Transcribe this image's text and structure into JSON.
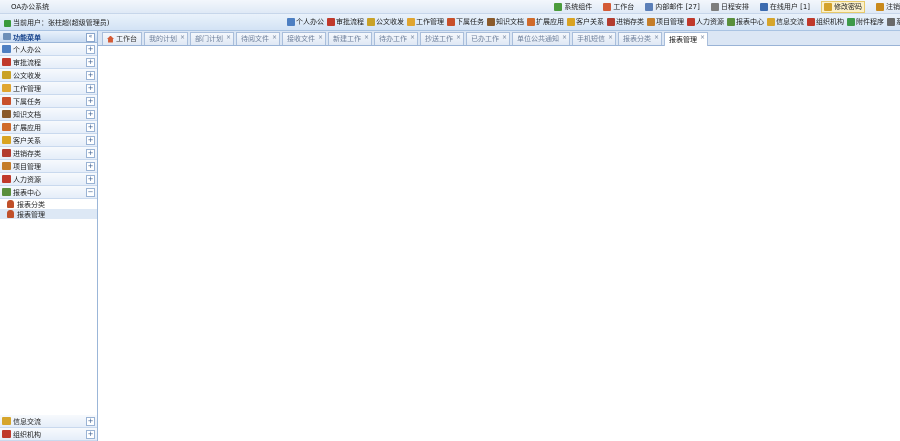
{
  "app": {
    "title": "OA办公系统"
  },
  "top_links": [
    {
      "label": "系统组件",
      "icon": "puzzle-icon",
      "color": "#4a9b3b"
    },
    {
      "label": "工作台",
      "icon": "home-icon",
      "color": "#d35a35"
    },
    {
      "label": "内部邮件 [27]",
      "icon": "mail-icon",
      "color": "#5b7fb8"
    },
    {
      "label": "日程安排",
      "icon": "calendar-icon",
      "color": "#7d7d7d"
    },
    {
      "label": "在线用户 [1]",
      "icon": "users-icon",
      "color": "#3b6bb0"
    },
    {
      "label": "修改密码",
      "icon": "key-icon",
      "color": "#d4a22a"
    },
    {
      "label": "注销",
      "icon": "logout-icon",
      "color": "#c98a1d"
    }
  ],
  "toolbar": {
    "current_user": "当前用户：张柱超(超级管理员)",
    "modules": [
      {
        "label": "个人办公",
        "icon": "personal-icon",
        "color": "#4d7fc2"
      },
      {
        "label": "审批流程",
        "icon": "approval-icon",
        "color": "#c0392b"
      },
      {
        "label": "公文收发",
        "icon": "document-icon",
        "color": "#c9a227"
      },
      {
        "label": "工作管理",
        "icon": "work-icon",
        "color": "#e0a530"
      },
      {
        "label": "下属任务",
        "icon": "task-icon",
        "color": "#c84f2a"
      },
      {
        "label": "知识文档",
        "icon": "knowledge-icon",
        "color": "#8a5a2b"
      },
      {
        "label": "扩展应用",
        "icon": "extension-icon",
        "color": "#d06a2a"
      },
      {
        "label": "客户关系",
        "icon": "customer-icon",
        "color": "#d9a322"
      },
      {
        "label": "进销存类",
        "icon": "inventory-icon",
        "color": "#b33c2f"
      },
      {
        "label": "项目管理",
        "icon": "project-icon",
        "color": "#c47d2a"
      },
      {
        "label": "人力资源",
        "icon": "hr-icon",
        "color": "#c0392b"
      },
      {
        "label": "报表中心",
        "icon": "report-icon",
        "color": "#5a8f3c"
      },
      {
        "label": "信息交流",
        "icon": "message-icon",
        "color": "#d6a52c"
      },
      {
        "label": "组织机构",
        "icon": "org-icon",
        "color": "#c0392b"
      },
      {
        "label": "附件程序",
        "icon": "attachment-icon",
        "color": "#3e9a4a"
      },
      {
        "label": "系统设置",
        "icon": "settings-icon",
        "color": "#6a6a6a"
      }
    ]
  },
  "sidebar": {
    "title": "功能菜单",
    "collapse_symbol": "«",
    "items": [
      {
        "label": "个人办公",
        "icon": "personal-icon",
        "color": "#4d7fc2",
        "toggle": "+"
      },
      {
        "label": "审批流程",
        "icon": "approval-icon",
        "color": "#c0392b",
        "toggle": "+"
      },
      {
        "label": "公文收发",
        "icon": "document-icon",
        "color": "#c9a227",
        "toggle": "+"
      },
      {
        "label": "工作管理",
        "icon": "work-icon",
        "color": "#e0a530",
        "toggle": "+"
      },
      {
        "label": "下属任务",
        "icon": "task-icon",
        "color": "#c84f2a",
        "toggle": "+"
      },
      {
        "label": "知识文档",
        "icon": "knowledge-icon",
        "color": "#8a5a2b",
        "toggle": "+"
      },
      {
        "label": "扩展应用",
        "icon": "extension-icon",
        "color": "#d06a2a",
        "toggle": "+"
      },
      {
        "label": "客户关系",
        "icon": "customer-icon",
        "color": "#d9a322",
        "toggle": "+"
      },
      {
        "label": "进销存类",
        "icon": "inventory-icon",
        "color": "#b33c2f",
        "toggle": "+"
      },
      {
        "label": "项目管理",
        "icon": "project-icon",
        "color": "#c47d2a",
        "toggle": "+"
      },
      {
        "label": "人力资源",
        "icon": "hr-icon",
        "color": "#c0392b",
        "toggle": "+"
      },
      {
        "label": "报表中心",
        "icon": "report-icon",
        "color": "#5a8f3c",
        "toggle": "−"
      }
    ],
    "sub_items": [
      {
        "label": "报表分类",
        "icon": "user-icon"
      },
      {
        "label": "报表管理",
        "icon": "user-icon"
      }
    ],
    "bottom_items": [
      {
        "label": "信息交流",
        "icon": "message-icon",
        "color": "#d6a52c",
        "toggle": "+"
      },
      {
        "label": "组织机构",
        "icon": "org-icon",
        "color": "#c0392b",
        "toggle": "+"
      }
    ]
  },
  "tabs": [
    {
      "label": "工作台",
      "closable": false,
      "active": false
    },
    {
      "label": "我的计划",
      "closable": true,
      "active": false
    },
    {
      "label": "部门计划",
      "closable": true,
      "active": false
    },
    {
      "label": "待阅文件",
      "closable": true,
      "active": false
    },
    {
      "label": "接收文件",
      "closable": true,
      "active": false
    },
    {
      "label": "新建工作",
      "closable": true,
      "active": false
    },
    {
      "label": "待办工作",
      "closable": true,
      "active": false
    },
    {
      "label": "抄送工作",
      "closable": true,
      "active": false
    },
    {
      "label": "已办工作",
      "closable": true,
      "active": false
    },
    {
      "label": "单位公共通知",
      "closable": true,
      "active": false
    },
    {
      "label": "手机短信",
      "closable": true,
      "active": false
    },
    {
      "label": "报表分类",
      "closable": true,
      "active": false
    },
    {
      "label": "报表管理",
      "closable": true,
      "active": true
    }
  ],
  "close_symbol": "×"
}
